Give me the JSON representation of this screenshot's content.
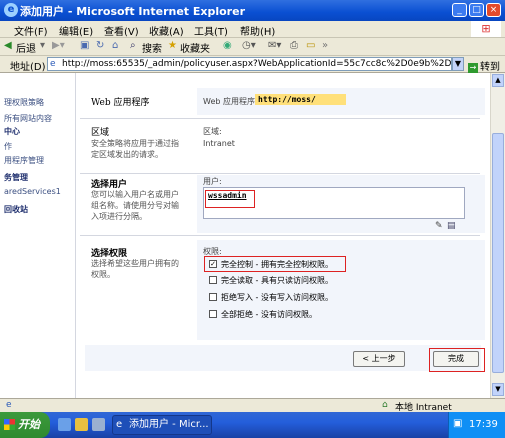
{
  "window": {
    "title": "添加用户 - Microsoft Internet Explorer"
  },
  "menu": [
    "文件(F)",
    "编辑(E)",
    "查看(V)",
    "收藏(A)",
    "工具(T)",
    "帮助(H)"
  ],
  "toolbar": {
    "back": "后退",
    "search": "搜索",
    "favorites": "收藏夹"
  },
  "address": {
    "label": "地址(D)",
    "url": "http://moss:65535/_admin/policyuser.aspx?WebApplicationId=55c7cc8c%2D0e9b%2D43d5%2Db66f",
    "go": "转到"
  },
  "leftnav": [
    "理权限策略",
    "所有网站内容",
    "中心",
    "作",
    "用程序管理",
    "务管理",
    "aredServices1",
    "回收站"
  ],
  "sections": {
    "webapp": {
      "heading": "Web 应用程序",
      "label": "Web 应用程序:",
      "value": "http://moss/"
    },
    "zone": {
      "heading": "区域",
      "desc": "安全策略将应用于通过指定区域发出的请求。",
      "label": "区域:",
      "value": "Intranet"
    },
    "users": {
      "heading": "选择用户",
      "desc": "您可以输入用户名或用户组名称。请使用分号对输入项进行分隔。",
      "label": "用户:",
      "value": "wssadmin"
    },
    "permissions": {
      "heading": "选择权限",
      "desc": "选择希望这些用户拥有的权限。",
      "label": "权限:",
      "options": [
        {
          "label": "完全控制 - 拥有完全控制权限。",
          "checked": true
        },
        {
          "label": "完全读取 - 具有只读访问权限。",
          "checked": false
        },
        {
          "label": "拒绝写入 - 没有写入访问权限。",
          "checked": false
        },
        {
          "label": "全部拒绝 - 没有访问权限。",
          "checked": false
        }
      ]
    }
  },
  "buttons": {
    "back": "< 上一步",
    "finish": "完成"
  },
  "status": {
    "zone": "本地 Intranet"
  },
  "taskbar": {
    "start": "开始",
    "task": "添加用户 - Micr...",
    "time": "17:39"
  }
}
